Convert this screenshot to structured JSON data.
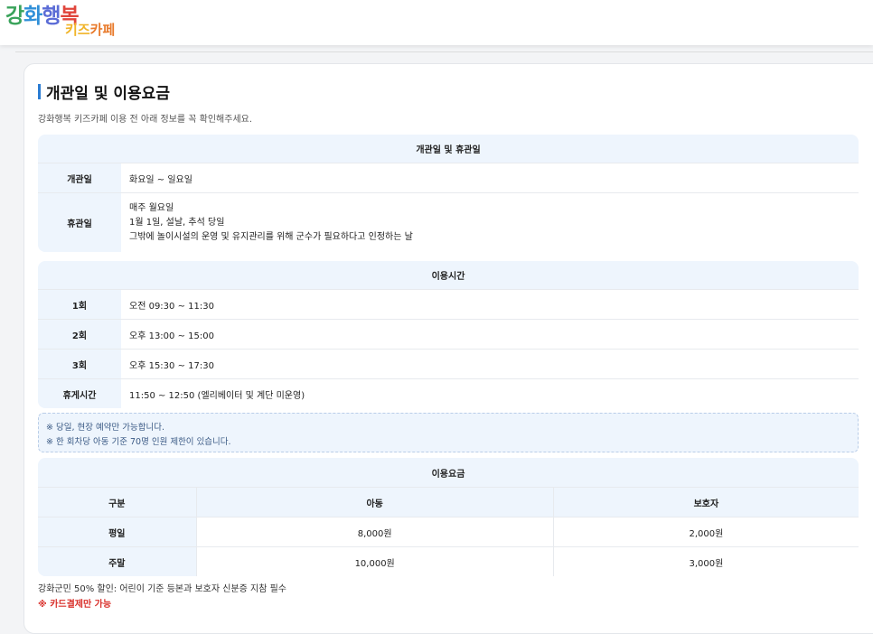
{
  "logo": {
    "main_chars": [
      {
        "ch": "강",
        "color": "#3aa35b"
      },
      {
        "ch": "화",
        "color": "#2f8fd8"
      },
      {
        "ch": "행",
        "color": "#5b6cd6"
      },
      {
        "ch": "복",
        "color": "#e0453b"
      }
    ],
    "sub_chars": [
      {
        "ch": "키",
        "color": "#f0b429"
      },
      {
        "ch": "즈",
        "color": "#f0b429"
      },
      {
        "ch": "카",
        "color": "#e87a2b"
      },
      {
        "ch": "페",
        "color": "#e87a2b"
      }
    ]
  },
  "page": {
    "title": "개관일 및 이용요금",
    "subtitle": "강화행복 키즈카페 이용 전 아래 정보를 꼭 확인해주세요."
  },
  "opening": {
    "caption": "개관일 및 휴관일",
    "rows": [
      {
        "key": "개관일",
        "value": [
          "화요일 ~ 일요일"
        ]
      },
      {
        "key": "휴관일",
        "value": [
          "매주 월요일",
          "1월 1일, 설날, 추석 당일",
          "그밖에 놀이시설의 운영 및 유지관리를 위해 군수가 필요하다고 인정하는 날"
        ]
      }
    ]
  },
  "hours": {
    "caption": "이용시간",
    "rows": [
      {
        "key": "1회",
        "value": "오전 09:30 ~ 11:30"
      },
      {
        "key": "2회",
        "value": "오후 13:00 ~ 15:00"
      },
      {
        "key": "3회",
        "value": "오후 15:30 ~ 17:30"
      },
      {
        "key": "휴게시간",
        "value": "11:50 ~ 12:50 (엘리베이터 및 계단 미운영)"
      }
    ]
  },
  "notice": {
    "line1": "※ 당일, 현장 예약만 가능합니다.",
    "line2": "※ 한 회차당 아동 기준 70명 인원 제한이 있습니다."
  },
  "fees": {
    "caption": "이용요금",
    "headers": [
      "구분",
      "아동",
      "보호자"
    ],
    "rows": [
      {
        "type": "평일",
        "child": "8,000원",
        "guardian": "2,000원"
      },
      {
        "type": "주말",
        "child": "10,000원",
        "guardian": "3,000원"
      }
    ]
  },
  "footnotes": {
    "discount": "강화군민 50% 할인: 어린이 기준 등본과 보호자 신분증 지참 필수",
    "card_only": "※ 카드결제만 가능"
  }
}
